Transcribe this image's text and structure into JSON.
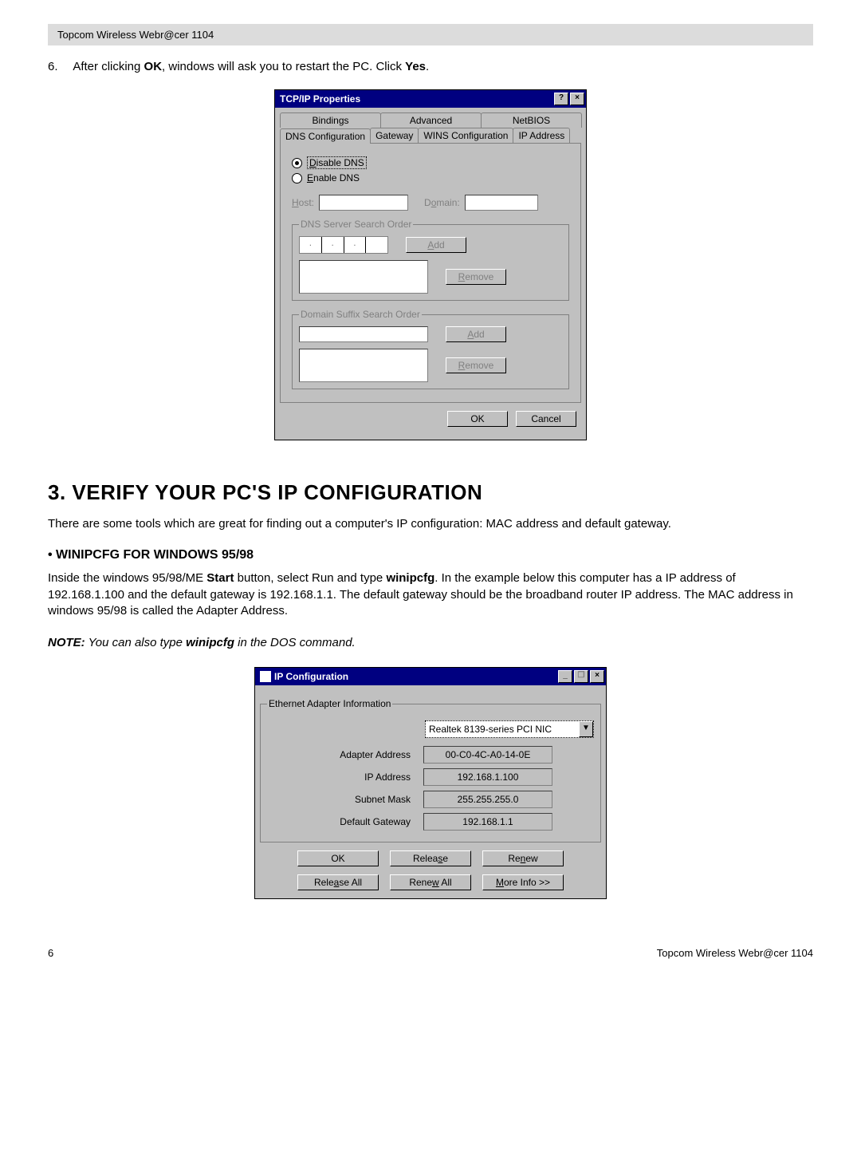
{
  "header": {
    "product": "Topcom Wireless Webr@cer 1104"
  },
  "step6": {
    "num": "6.",
    "before_ok": "After clicking ",
    "ok": "OK",
    "after_ok": ", windows will ask you to restart the PC. Click ",
    "yes": "Yes",
    "period": "."
  },
  "tcpip": {
    "title": "TCP/IP Properties",
    "help_glyph": "?",
    "close_glyph": "×",
    "tabs_row1": [
      "Bindings",
      "Advanced",
      "NetBIOS"
    ],
    "tabs_row2": [
      "DNS Configuration",
      "Gateway",
      "WINS Configuration",
      "IP Address"
    ],
    "active_tab": "DNS Configuration",
    "radio_disable_pre": "D",
    "radio_disable": "isable DNS",
    "radio_enable_pre": "E",
    "radio_enable": "nable DNS",
    "host_label_pre": "H",
    "host_label": "ost:",
    "domain_label_pre": "o",
    "domain_label_before": "D",
    "domain_label_after": "main:",
    "dns_order_legend": "DNS Server Search Order",
    "suffix_order_legend": "Domain Suffix Search Order",
    "add_pre": "A",
    "add_label": "dd",
    "remove_pre": "R",
    "remove_label": "emove",
    "ok": "OK",
    "cancel": "Cancel"
  },
  "section3": {
    "heading": "3. VERIFY YOUR PC'S IP CONFIGURATION",
    "intro": "There are some tools which are great for finding out a computer's IP configuration: MAC address and default gateway."
  },
  "winipcfg": {
    "bullet_heading": "• WINIPCFG FOR WINDOWS 95/98",
    "p_before_start": "Inside the windows 95/98/ME ",
    "start": "Start",
    "p_mid1": " button, select Run and type ",
    "winipcfg": "winipcfg",
    "p_mid2": ". In the example below this computer has a IP address of 192.168.1.100 and the default gateway is 192.168.1.1. The default gateway should be the broadband router IP address. The MAC address in windows 95/98 is called the Adapter Address.",
    "note_prefix": "NOTE:",
    "note_mid1": " You can also type ",
    "note_cmd": "winipcfg",
    "note_mid2": " in the DOS command."
  },
  "ipcfg": {
    "title": "IP Configuration",
    "min_glyph": "_",
    "restore_glyph": "❐",
    "close_glyph": "×",
    "group": "Ethernet Adapter Information",
    "adapter_selected": "Realtek 8139-series PCI NIC",
    "dropdown_glyph": "▼",
    "rows": [
      {
        "k": "Adapter Address",
        "v": "00-C0-4C-A0-14-0E"
      },
      {
        "k": "IP Address",
        "v": "192.168.1.100"
      },
      {
        "k": "Subnet Mask",
        "v": "255.255.255.0"
      },
      {
        "k": "Default Gateway",
        "v": "192.168.1.1"
      }
    ],
    "buttons_row1": [
      {
        "label": "OK",
        "u": ""
      },
      {
        "label": "Relea",
        "u": "s",
        "label2": "e"
      },
      {
        "label": "Re",
        "u": "n",
        "label2": "ew"
      }
    ],
    "buttons_row2": [
      {
        "label": "Rele",
        "u": "a",
        "label2": "se All"
      },
      {
        "label": "Rene",
        "u": "w",
        "label2": " All"
      },
      {
        "label": "",
        "u": "M",
        "label2": "ore Info >>"
      }
    ]
  },
  "footer": {
    "page": "6",
    "product": "Topcom Wireless Webr@cer 1104"
  }
}
